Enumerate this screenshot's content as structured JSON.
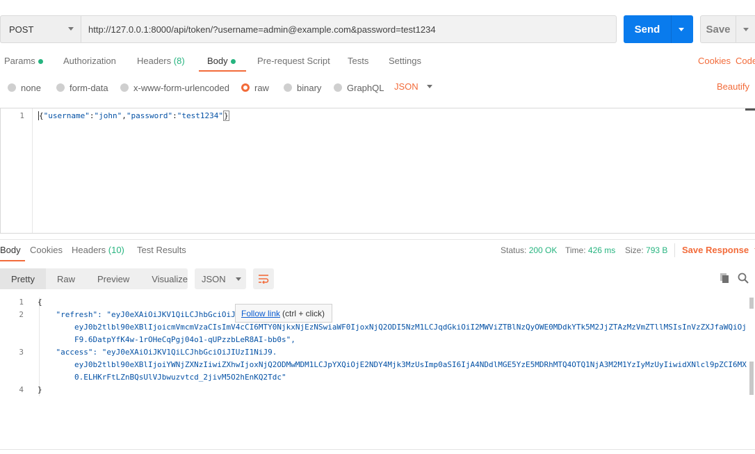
{
  "request": {
    "method": "POST",
    "url": "http://127.0.0.1:8000/api/token/?username=admin@example.com&password=test1234",
    "send_label": "Send",
    "save_label": "Save"
  },
  "request_tabs": {
    "params": "Params",
    "authorization": "Authorization",
    "headers": "Headers",
    "headers_count": "(8)",
    "body": "Body",
    "pre_request": "Pre-request Script",
    "tests": "Tests",
    "settings": "Settings",
    "cookies": "Cookies",
    "code": "Code"
  },
  "body_types": {
    "none": "none",
    "form_data": "form-data",
    "urlencoded": "x-www-form-urlencoded",
    "raw": "raw",
    "binary": "binary",
    "graphql": "GraphQL",
    "format": "JSON",
    "beautify": "Beautify"
  },
  "editor": {
    "line1_no": "1",
    "brace_open": "{",
    "key1": "\"username\"",
    "colon1": ":",
    "val1": "\"john\"",
    "comma1": ",",
    "key2": "\"password\"",
    "colon2": ":",
    "val2": "\"test1234\"",
    "brace_close": "}"
  },
  "response_tabs": {
    "body": "Body",
    "cookies": "Cookies",
    "headers": "Headers",
    "headers_count": "(10)",
    "test_results": "Test Results"
  },
  "response_status": {
    "status_label": "Status:",
    "status_value": "200 OK",
    "time_label": "Time:",
    "time_value": "426 ms",
    "size_label": "Size:",
    "size_value": "793 B",
    "save_response": "Save Response"
  },
  "response_view": {
    "pretty": "Pretty",
    "raw": "Raw",
    "preview": "Preview",
    "visualize": "Visualize",
    "format": "JSON"
  },
  "response_body": {
    "lines": [
      {
        "no": "1",
        "text": "{"
      },
      {
        "no": "2",
        "text": "    \"refresh\": \"eyJ0eXAiOiJKV1QiLCJhbGciOiJ"
      },
      {
        "no": "",
        "text": "        eyJ0b2tlbl90eXBlIjoicmVmcmVzaCIsImV4cCI6MTY0NjkxNjEzNSwiaWF0IjoxNjQ2ODI5NzM1LCJqdGkiOiI2MWViZTBlNzQyOWE0MDdkYTk5M2JjZTAzMzVmZTllMSIsInVzZXJfaWQiOj"
      },
      {
        "no": "",
        "text": "        F9.6DatpYfK4w-1rOHeCqPgj04o1-qUPzzbLeR8AI-bb0s\","
      },
      {
        "no": "3",
        "text": "    \"access\": \"eyJ0eXAiOiJKV1QiLCJhbGciOiJIUzI1NiJ9."
      },
      {
        "no": "",
        "text": "        eyJ0b2tlbl90eXBlIjoiYWNjZXNzIiwiZXhwIjoxNjQ2ODMwMDM1LCJpYXQiOjE2NDY4Mjk3MzUsImp0aSI6IjA4NDdlMGE5YzE5MDRhMTQ4OTQ1NjA3M2M1YzIyMzUyIiwidXNlcl9pZCI6MX"
      },
      {
        "no": "",
        "text": "        0.ELHKrFtLZnBQsUlVJbwuzvtcd_2jivM5O2hEnKQ2Tdc\""
      },
      {
        "no": "4",
        "text": "}"
      }
    ]
  },
  "tooltip": {
    "link": "Follow link",
    "hint": "(ctrl + click)"
  },
  "icons": {
    "copy": "copy-icon",
    "search": "search-icon",
    "wrap": "wrap-lines-icon"
  },
  "colors": {
    "accent": "#f26b3a",
    "send": "#097bed",
    "success": "#26b47f"
  }
}
